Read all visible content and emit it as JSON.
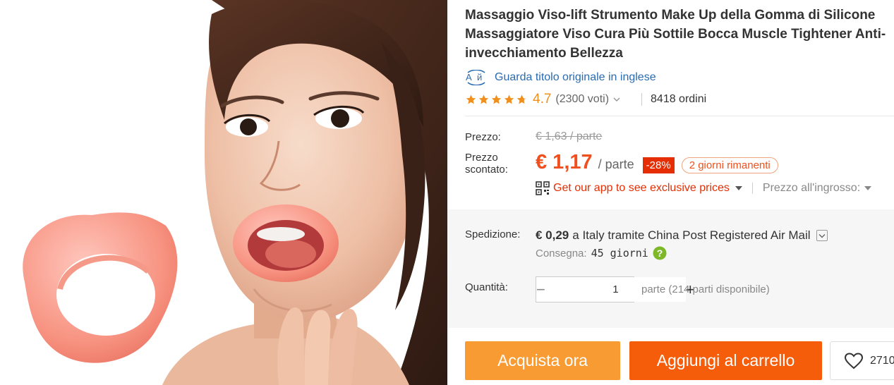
{
  "product": {
    "title": "Massaggio Viso-lift Strumento Make Up della Gomma di Silicone Massaggiatore Viso Cura Più Sottile Bocca Muscle Tightener Anti-invecchiamento Bellezza",
    "translate_link": "Guarda titolo originale in inglese",
    "translate_icon": "translate-icon"
  },
  "rating": {
    "stars": 4.7,
    "value": "4.7",
    "votes": "(2300 voti)",
    "orders": "8418 ordini",
    "star_color": "#f08f1e"
  },
  "pricing": {
    "old_label": "Prezzo:",
    "old_price": "€ 1,63 / parte",
    "discount_label": "Prezzo scontato:",
    "current_price": "€ 1,17",
    "unit": "/ parte",
    "discount": "-28%",
    "days_left": "2 giorni rimanenti",
    "app_link": "Get our app to see exclusive prices",
    "wholesale": "Prezzo all'ingrosso:",
    "price_color": "#f0501e"
  },
  "shipping": {
    "label": "Spedizione:",
    "price": "€ 0,29",
    "method": "a Italy tramite China Post Registered Air Mail",
    "delivery_label": "Consegna:",
    "delivery_days": "45 giorni"
  },
  "quantity": {
    "label": "Quantità:",
    "value": "1",
    "minus": "−",
    "plus": "+",
    "note": "parte (214 parti disponibile)"
  },
  "actions": {
    "buy_now": "Acquista ora",
    "add_to_cart": "Aggiungi al carrello",
    "wishlist_count": "2710",
    "buy_color": "#f89b32",
    "cart_color": "#f55d0a"
  }
}
